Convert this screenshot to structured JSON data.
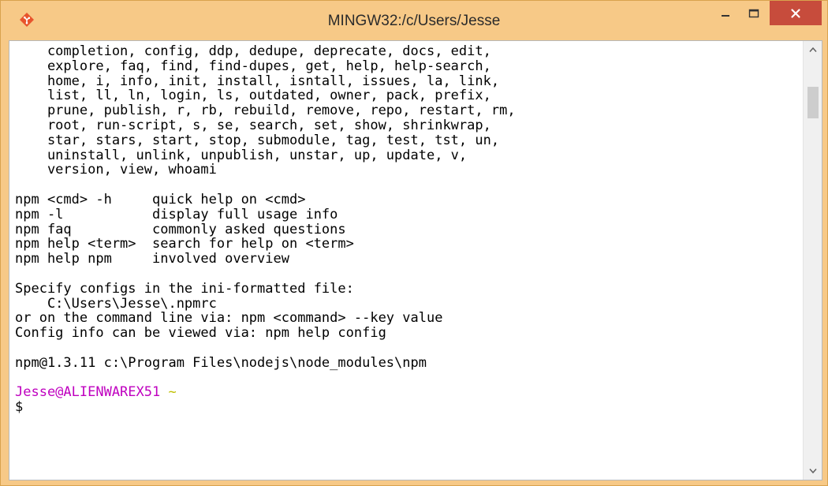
{
  "window": {
    "title": "MINGW32:/c/Users/Jesse",
    "icon": "git-icon",
    "controls": [
      "minimize-icon",
      "maximize-icon",
      "close-icon"
    ],
    "colors": {
      "frame": "#f7c987",
      "close_button": "#c74c3c",
      "terminal_background": "#ffffff",
      "terminal_text": "#000000",
      "prompt_user_host": "#bf00bf",
      "prompt_path": "#bfbf00"
    }
  },
  "terminal": {
    "lines": [
      "    completion, config, ddp, dedupe, deprecate, docs, edit,",
      "    explore, faq, find, find-dupes, get, help, help-search,",
      "    home, i, info, init, install, isntall, issues, la, link,",
      "    list, ll, ln, login, ls, outdated, owner, pack, prefix,",
      "    prune, publish, r, rb, rebuild, remove, repo, restart, rm,",
      "    root, run-script, s, se, search, set, show, shrinkwrap,",
      "    star, stars, start, stop, submodule, tag, test, tst, un,",
      "    uninstall, unlink, unpublish, unstar, up, update, v,",
      "    version, view, whoami",
      "",
      "npm <cmd> -h     quick help on <cmd>",
      "npm -l           display full usage info",
      "npm faq          commonly asked questions",
      "npm help <term>  search for help on <term>",
      "npm help npm     involved overview",
      "",
      "Specify configs in the ini-formatted file:",
      "    C:\\Users\\Jesse\\.npmrc",
      "or on the command line via: npm <command> --key value",
      "Config info can be viewed via: npm help config",
      "",
      "npm@1.3.11 c:\\Program Files\\nodejs\\node_modules\\npm",
      ""
    ],
    "prompt": {
      "user_host": "Jesse@ALIENWAREX51",
      "path": "~",
      "symbol": "$"
    }
  },
  "scrollbar": {
    "up_icon": "scroll-up-arrow-icon",
    "down_icon": "scroll-down-arrow-icon"
  }
}
